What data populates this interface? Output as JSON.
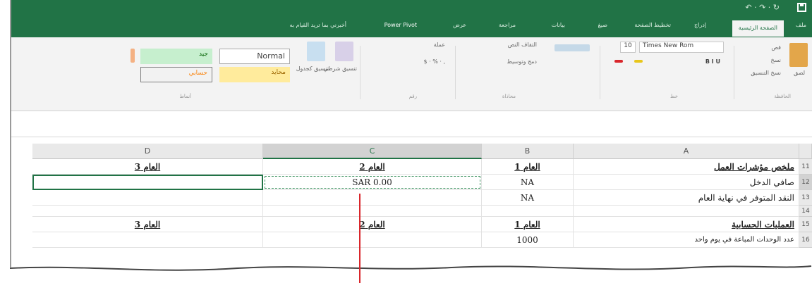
{
  "window": {
    "quick_access": "↶ · ↷ · ↻",
    "accent": "#217346"
  },
  "tabs": [
    {
      "label": "ملف"
    },
    {
      "label": "الصفحة الرئيسية",
      "active": true
    },
    {
      "label": "إدراج"
    },
    {
      "label": "تخطيط الصفحة"
    },
    {
      "label": "صيغ"
    },
    {
      "label": "بيانات"
    },
    {
      "label": "مراجعة"
    },
    {
      "label": "عرض"
    },
    {
      "label": "Power Pivot"
    },
    {
      "label": "أخبرني بما تريد القيام به"
    }
  ],
  "ribbon": {
    "clipboard": {
      "paste": "لصق",
      "cut": "قص",
      "copy": "نسخ",
      "format_painter": "نسخ التنسيق",
      "label": "الحافظة"
    },
    "font": {
      "name": "Times New Rom",
      "size": "10",
      "label": "خط"
    },
    "alignment": {
      "wrap": "التفاف النص",
      "merge": "دمج وتوسيط",
      "label": "محاذاة"
    },
    "number": {
      "format": "عملة",
      "label": "رقم"
    },
    "styles": {
      "conditional": "تنسيق شرطي",
      "table": "تنسيق كجدول",
      "normal": "Normal",
      "bad": "جيد",
      "neutral": "محايد",
      "calc": "حسابي",
      "label": "أنماط"
    }
  },
  "sheet": {
    "columns": [
      "A",
      "B",
      "C",
      "D"
    ],
    "rows": [
      {
        "num": "11",
        "A": "ملخص مؤشرات العمل",
        "B": "العام 1",
        "C": "العام 2",
        "D": "العام 3"
      },
      {
        "num": "12",
        "A": "صافي الدخل",
        "B": "NA",
        "C": "SAR 0.00",
        "D": ""
      },
      {
        "num": "13",
        "A": "النقد المتوفر في نهاية العام",
        "B": "NA",
        "C": "",
        "D": ""
      },
      {
        "num": "14",
        "A": "",
        "B": "",
        "C": "",
        "D": ""
      },
      {
        "num": "15",
        "A": "العمليات الحسابية",
        "B": "العام 1",
        "C": "العام 2",
        "D": "العام 3"
      },
      {
        "num": "16",
        "A": "عدد الوحدات المباعة في يوم واحد",
        "B": "1000",
        "C": "",
        "D": ""
      }
    ]
  }
}
